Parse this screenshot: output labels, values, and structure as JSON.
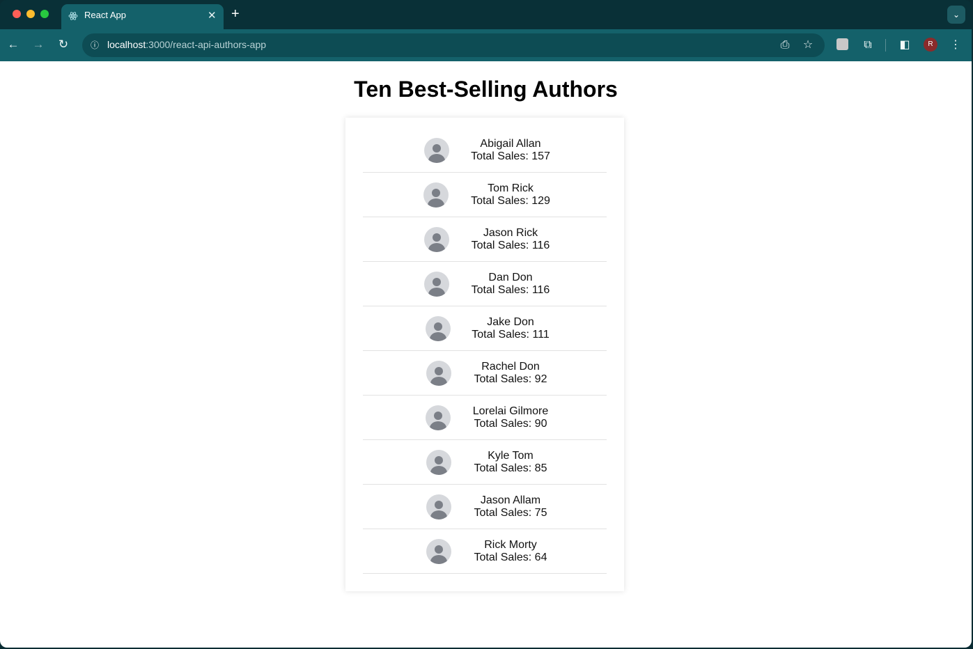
{
  "browser": {
    "tab_title": "React App",
    "tab_close": "✕",
    "new_tab": "+",
    "tab_menu": "⌄",
    "url_host": "localhost",
    "url_path": ":3000/react-api-authors-app",
    "profile_initial": "R",
    "icons": {
      "back": "back-arrow-icon",
      "forward": "forward-arrow-icon",
      "reload": "reload-icon",
      "site_info": "info-icon",
      "install": "install-app-icon",
      "bookmark": "star-icon",
      "extension": "extension-icon",
      "puzzle": "puzzle-icon",
      "side_panel": "side-panel-icon",
      "menu": "kebab-menu-icon"
    }
  },
  "page": {
    "title": "Ten Best-Selling Authors",
    "authors": [
      {
        "name": "Abigail Allan",
        "sales": "Total Sales: 157"
      },
      {
        "name": "Tom Rick",
        "sales": "Total Sales: 129"
      },
      {
        "name": "Jason Rick",
        "sales": "Total Sales: 116"
      },
      {
        "name": "Dan Don",
        "sales": "Total Sales: 116"
      },
      {
        "name": "Jake Don",
        "sales": "Total Sales: 111"
      },
      {
        "name": "Rachel Don",
        "sales": "Total Sales: 92"
      },
      {
        "name": "Lorelai Gilmore",
        "sales": "Total Sales: 90"
      },
      {
        "name": "Kyle Tom",
        "sales": "Total Sales: 85"
      },
      {
        "name": "Jason Allam",
        "sales": "Total Sales: 75"
      },
      {
        "name": "Rick Morty",
        "sales": "Total Sales: 64"
      }
    ]
  },
  "colors": {
    "tab_active": "#14616a",
    "toolbar": "#14616a",
    "tabstrip": "#093037",
    "avatar_bg": "#d6d8dc",
    "avatar_fg": "#7b7f87"
  }
}
